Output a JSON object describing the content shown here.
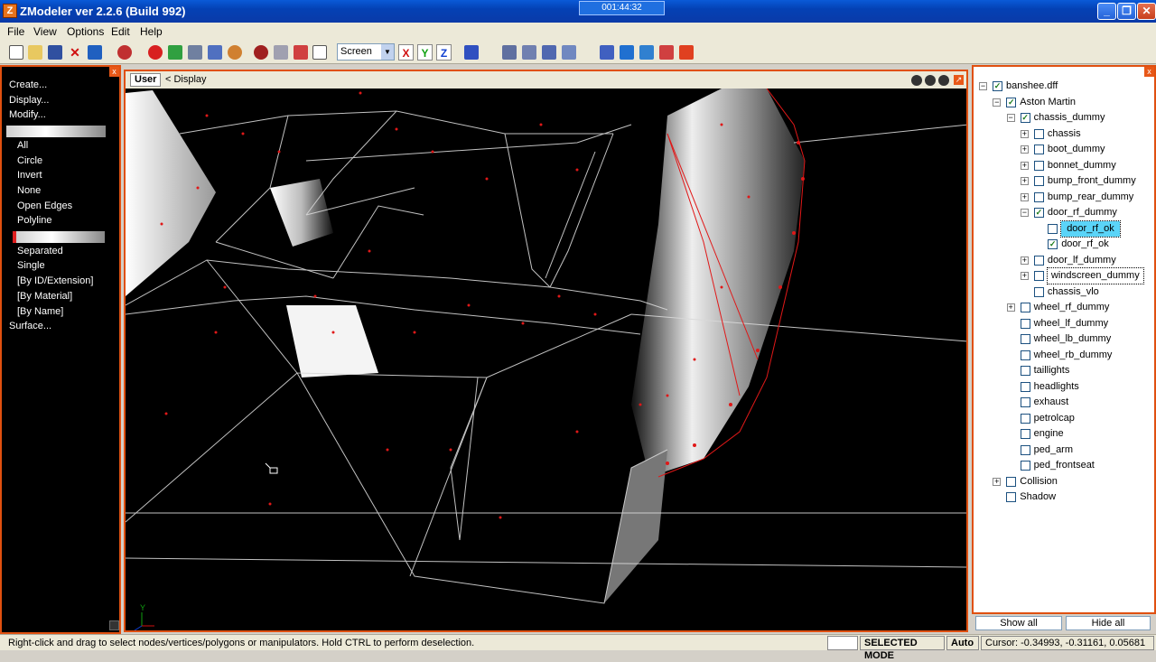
{
  "window": {
    "title": "ZModeler ver 2.2.6 (Build 992)",
    "app_icon": "Z",
    "timer": "001:44:32",
    "minimize_label": "_",
    "maximize_label": "❐",
    "close_label": "✕"
  },
  "menu": [
    "File",
    "View",
    "Options",
    "Edit",
    "Help"
  ],
  "toolbar": {
    "coord_mode": "Screen",
    "axes": [
      "X",
      "Y",
      "Z"
    ],
    "axis_colors": [
      "#d01010",
      "#10a010",
      "#1040d0"
    ]
  },
  "left_panel": {
    "close_label": "x",
    "items": [
      {
        "label": "Create...",
        "indent": 0
      },
      {
        "label": "Display...",
        "indent": 0
      },
      {
        "label": "Modify...",
        "indent": 0
      },
      {
        "label": "",
        "indent": 1,
        "bar": true
      },
      {
        "label": "All",
        "indent": 2
      },
      {
        "label": "Circle",
        "indent": 2
      },
      {
        "label": "Invert",
        "indent": 2
      },
      {
        "label": "None",
        "indent": 2
      },
      {
        "label": "Open Edges",
        "indent": 2
      },
      {
        "label": "Polyline",
        "indent": 2
      },
      {
        "label": "",
        "indent": 2,
        "bar": true
      },
      {
        "label": "Separated",
        "indent": 2
      },
      {
        "label": "Single",
        "indent": 2
      },
      {
        "label": "[By ID/Extension]",
        "indent": 2
      },
      {
        "label": "[By Material]",
        "indent": 2
      },
      {
        "label": "[By Name]",
        "indent": 2
      },
      {
        "label": "Surface...",
        "indent": 0
      }
    ]
  },
  "viewport": {
    "view_name": "User",
    "display_label": "< Display",
    "axis_label": "Y"
  },
  "scene_tree": {
    "close_label": "x",
    "nodes": [
      {
        "label": "banshee.dff",
        "depth": 0,
        "expander": "-",
        "checked": true
      },
      {
        "label": "Aston Martin",
        "depth": 1,
        "expander": "-",
        "checked": true
      },
      {
        "label": "chassis_dummy",
        "depth": 2,
        "expander": "-",
        "checked": true
      },
      {
        "label": "chassis",
        "depth": 3,
        "expander": "+",
        "checked": false
      },
      {
        "label": "boot_dummy",
        "depth": 3,
        "expander": "+",
        "checked": false
      },
      {
        "label": "bonnet_dummy",
        "depth": 3,
        "expander": "+",
        "checked": false
      },
      {
        "label": "bump_front_dummy",
        "depth": 3,
        "expander": "+",
        "checked": false
      },
      {
        "label": "bump_rear_dummy",
        "depth": 3,
        "expander": "+",
        "checked": false
      },
      {
        "label": "door_rf_dummy",
        "depth": 3,
        "expander": "-",
        "checked": true
      },
      {
        "label": "door_rf_ok",
        "depth": 4,
        "expander": "",
        "checked": false,
        "state": "highlight"
      },
      {
        "label": "door_rf_ok",
        "depth": 4,
        "expander": "",
        "checked": true
      },
      {
        "label": "door_lf_dummy",
        "depth": 3,
        "expander": "+",
        "checked": false
      },
      {
        "label": "windscreen_dummy",
        "depth": 3,
        "expander": "+",
        "checked": false,
        "state": "focus"
      },
      {
        "label": "chassis_vlo",
        "depth": 3,
        "expander": "",
        "checked": false
      },
      {
        "label": "wheel_rf_dummy",
        "depth": 2,
        "expander": "+",
        "checked": false
      },
      {
        "label": "wheel_lf_dummy",
        "depth": 2,
        "expander": "",
        "checked": false
      },
      {
        "label": "wheel_lb_dummy",
        "depth": 2,
        "expander": "",
        "checked": false
      },
      {
        "label": "wheel_rb_dummy",
        "depth": 2,
        "expander": "",
        "checked": false
      },
      {
        "label": "taillights",
        "depth": 2,
        "expander": "",
        "checked": false
      },
      {
        "label": "headlights",
        "depth": 2,
        "expander": "",
        "checked": false
      },
      {
        "label": "exhaust",
        "depth": 2,
        "expander": "",
        "checked": false
      },
      {
        "label": "petrolcap",
        "depth": 2,
        "expander": "",
        "checked": false
      },
      {
        "label": "engine",
        "depth": 2,
        "expander": "",
        "checked": false
      },
      {
        "label": "ped_arm",
        "depth": 2,
        "expander": "",
        "checked": false
      },
      {
        "label": "ped_frontseat",
        "depth": 2,
        "expander": "",
        "checked": false
      },
      {
        "label": "Collision",
        "depth": 1,
        "expander": "+",
        "checked": false
      },
      {
        "label": "Shadow",
        "depth": 1,
        "expander": "",
        "checked": false
      }
    ],
    "show_all_label": "Show all",
    "hide_all_label": "Hide all"
  },
  "status": {
    "hint": "Right-click and drag to select nodes/vertices/polygons or manipulators. Hold CTRL to perform deselection.",
    "mode": "SELECTED MODE",
    "auto": "Auto",
    "cursor": "Cursor: -0.34993, -0.31161, 0.05681"
  },
  "colors": {
    "accent": "#e05010",
    "vertex": "#e01818",
    "wire": "#d8d8d8"
  }
}
